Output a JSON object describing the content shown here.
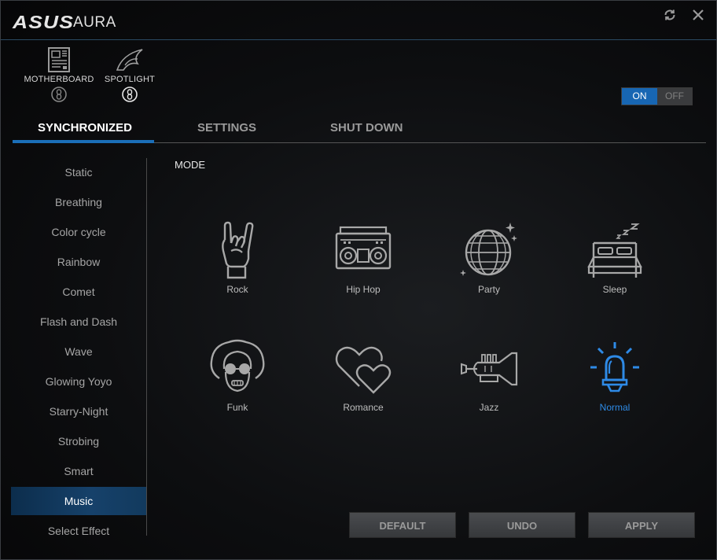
{
  "titlebar": {
    "logo_text": "ASUS",
    "app_title": "AURA",
    "refresh_icon": "refresh-icon",
    "close_icon": "close-icon"
  },
  "devices": [
    {
      "label": "MOTHERBOARD",
      "icon": "motherboard-icon",
      "badge_icon": "sync-link-icon"
    },
    {
      "label": "SPOTLIGHT",
      "icon": "rog-eye-icon",
      "badge_icon": "sync-link-icon"
    }
  ],
  "power_toggle": {
    "on_label": "ON",
    "off_label": "OFF",
    "state": "ON"
  },
  "tabs": [
    {
      "label": "SYNCHRONIZED",
      "active": true
    },
    {
      "label": "SETTINGS",
      "active": false
    },
    {
      "label": "SHUT DOWN",
      "active": false
    }
  ],
  "sidebar": {
    "items": [
      {
        "label": "Static"
      },
      {
        "label": "Breathing"
      },
      {
        "label": "Color cycle"
      },
      {
        "label": "Rainbow"
      },
      {
        "label": "Comet"
      },
      {
        "label": "Flash and Dash"
      },
      {
        "label": "Wave"
      },
      {
        "label": "Glowing Yoyo"
      },
      {
        "label": "Starry-Night"
      },
      {
        "label": "Strobing"
      },
      {
        "label": "Smart"
      },
      {
        "label": "Music"
      },
      {
        "label": "Select Effect"
      }
    ],
    "active": "Music"
  },
  "mode": {
    "heading": "MODE",
    "selected": "Normal",
    "items": [
      {
        "label": "Rock",
        "icon": "rock-hand-icon"
      },
      {
        "label": "Hip Hop",
        "icon": "boombox-icon"
      },
      {
        "label": "Party",
        "icon": "disco-ball-icon"
      },
      {
        "label": "Sleep",
        "icon": "bed-icon"
      },
      {
        "label": "Funk",
        "icon": "afro-face-icon"
      },
      {
        "label": "Romance",
        "icon": "hearts-icon"
      },
      {
        "label": "Jazz",
        "icon": "trumpet-icon"
      },
      {
        "label": "Normal",
        "icon": "light-bulb-icon"
      }
    ]
  },
  "buttons": {
    "default_label": "DEFAULT",
    "undo_label": "UNDO",
    "apply_label": "APPLY"
  },
  "colors": {
    "accent": "#1b6fb8",
    "selected_mode": "#2e8ae6",
    "toggle_on": "#1766b3"
  }
}
